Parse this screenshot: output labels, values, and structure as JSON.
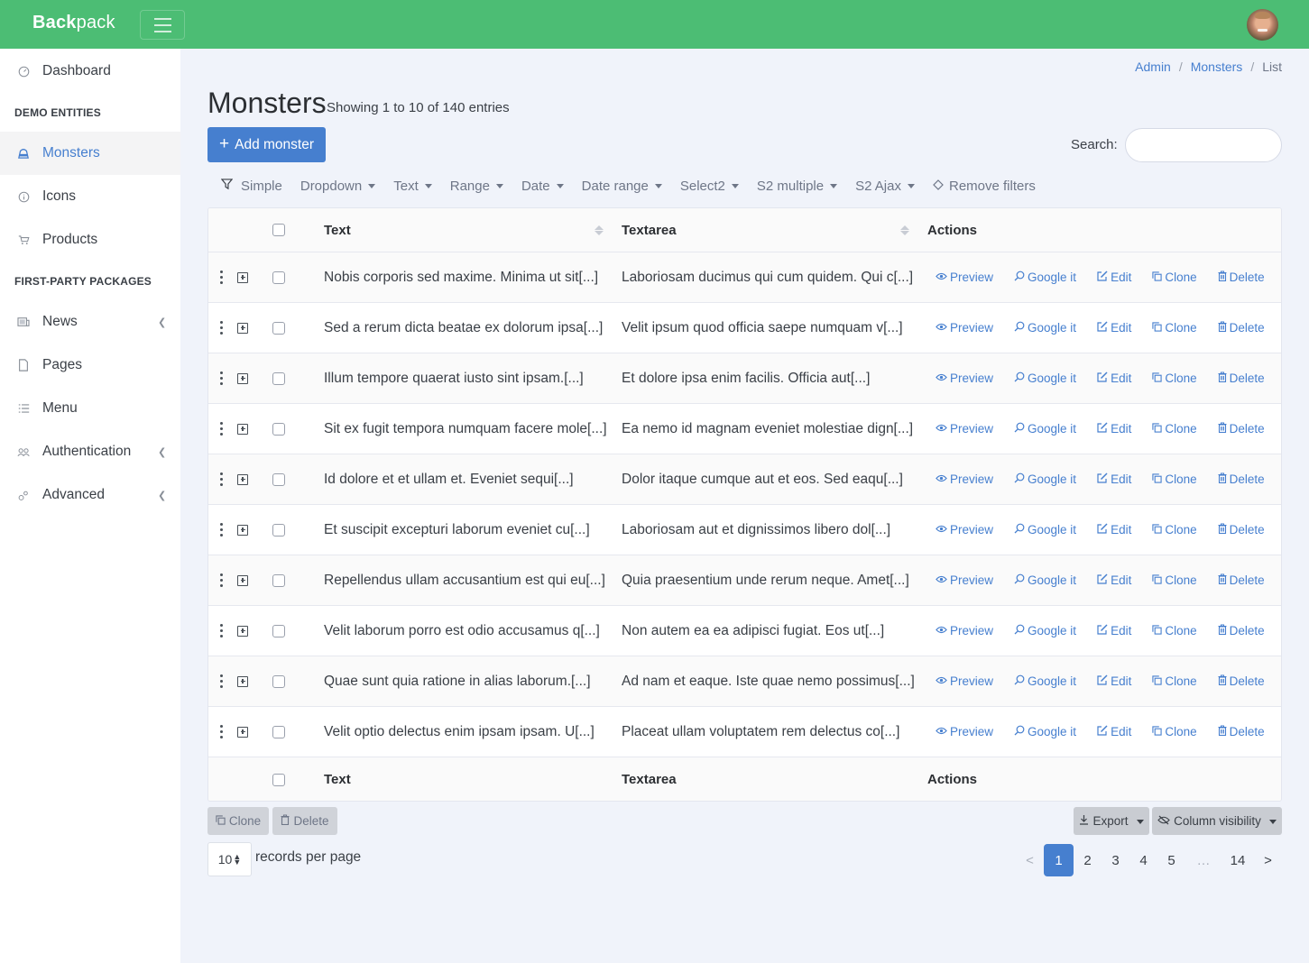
{
  "app": {
    "brand_bold": "Back",
    "brand_light": "pack",
    "accent_color": "#467fcf",
    "header_color": "#4cbd74"
  },
  "sidebar": {
    "items": [
      {
        "label": "Dashboard",
        "icon": "dashboard-icon",
        "active": false
      },
      {
        "label": "Monsters",
        "icon": "monster-icon",
        "active": true
      },
      {
        "label": "Icons",
        "icon": "info-icon",
        "active": false
      },
      {
        "label": "Products",
        "icon": "cart-icon",
        "active": false
      },
      {
        "label": "News",
        "icon": "newspaper-icon",
        "active": false,
        "has_children": true
      },
      {
        "label": "Pages",
        "icon": "file-icon",
        "active": false
      },
      {
        "label": "Menu",
        "icon": "list-icon",
        "active": false
      },
      {
        "label": "Authentication",
        "icon": "users-icon",
        "active": false,
        "has_children": true
      },
      {
        "label": "Advanced",
        "icon": "cogs-icon",
        "active": false,
        "has_children": true
      }
    ],
    "headings": [
      "DEMO ENTITIES",
      "FIRST-PARTY PACKAGES"
    ]
  },
  "breadcrumb": {
    "items": [
      "Admin",
      "Monsters"
    ],
    "current": "List",
    "separator": "/"
  },
  "page": {
    "title": "Monsters",
    "subtitle": "Showing 1 to 10 of 140 entries",
    "add_button": "Add monster",
    "search_label": "Search:",
    "search_value": ""
  },
  "filters": {
    "simple": "Simple",
    "dropdowns": [
      "Dropdown",
      "Text",
      "Range",
      "Date",
      "Date range",
      "Select2",
      "S2 multiple",
      "S2 Ajax"
    ],
    "remove": "Remove filters"
  },
  "table": {
    "columns": {
      "text": "Text",
      "textarea": "Textarea",
      "actions": "Actions"
    },
    "action_labels": {
      "preview": "Preview",
      "google": "Google it",
      "edit": "Edit",
      "clone": "Clone",
      "delete": "Delete"
    },
    "rows": [
      {
        "text": "Nobis corporis sed maxime. Minima ut sit[...]",
        "textarea": "Laboriosam ducimus qui cum quidem. Qui c[...]"
      },
      {
        "text": "Sed a rerum dicta beatae ex dolorum ipsa[...]",
        "textarea": "Velit ipsum quod officia saepe numquam v[...]"
      },
      {
        "text": "Illum tempore quaerat iusto sint ipsam.[...]",
        "textarea": "Et dolore ipsa enim facilis. Officia aut[...]"
      },
      {
        "text": "Sit ex fugit tempora numquam facere mole[...]",
        "textarea": "Ea nemo id magnam eveniet molestiae dign[...]"
      },
      {
        "text": "Id dolore et et ullam et. Eveniet sequi[...]",
        "textarea": "Dolor itaque cumque aut et eos. Sed eaqu[...]"
      },
      {
        "text": "Et suscipit excepturi laborum eveniet cu[...]",
        "textarea": "Laboriosam aut et dignissimos libero dol[...]"
      },
      {
        "text": "Repellendus ullam accusantium est qui eu[...]",
        "textarea": "Quia praesentium unde rerum neque. Amet[...]"
      },
      {
        "text": "Velit laborum porro est odio accusamus q[...]",
        "textarea": "Non autem ea ea adipisci fugiat. Eos ut[...]"
      },
      {
        "text": "Quae sunt quia ratione in alias laborum.[...]",
        "textarea": "Ad nam et eaque. Iste quae nemo possimus[...]"
      },
      {
        "text": "Velit optio delectus enim ipsam ipsam. U[...]",
        "textarea": "Placeat ullam voluptatem rem delectus co[...]"
      }
    ]
  },
  "bulk": {
    "clone": "Clone",
    "delete": "Delete"
  },
  "tools": {
    "export": "Export",
    "column_visibility": "Column visibility"
  },
  "footer": {
    "per_page_value": "10",
    "per_page_label": "records per page"
  },
  "pagination": {
    "prev": "<",
    "next": ">",
    "pages": [
      "1",
      "2",
      "3",
      "4",
      "5"
    ],
    "ellipsis": "…",
    "last": "14",
    "current": "1"
  }
}
